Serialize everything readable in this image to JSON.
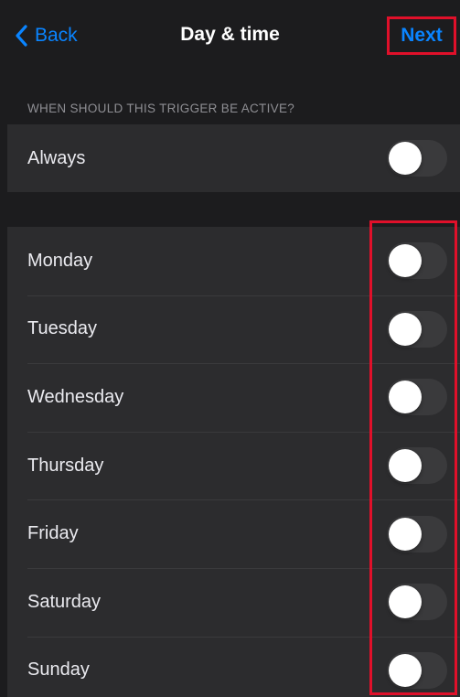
{
  "navbar": {
    "back_label": "Back",
    "title": "Day & time",
    "next_label": "Next"
  },
  "section": {
    "header": "WHEN SHOULD THIS TRIGGER BE ACTIVE?"
  },
  "always": {
    "label": "Always",
    "on": false
  },
  "days": [
    {
      "label": "Monday",
      "on": false
    },
    {
      "label": "Tuesday",
      "on": false
    },
    {
      "label": "Wednesday",
      "on": false
    },
    {
      "label": "Thursday",
      "on": false
    },
    {
      "label": "Friday",
      "on": false
    },
    {
      "label": "Saturday",
      "on": false
    },
    {
      "label": "Sunday",
      "on": false
    }
  ],
  "colors": {
    "accent": "#0a84ff",
    "highlight": "#e0102a",
    "background": "#1c1c1e",
    "row_background": "#2c2c2e",
    "toggle_off": "#3a3a3c"
  },
  "icons": {
    "back": "chevron-left-icon"
  }
}
